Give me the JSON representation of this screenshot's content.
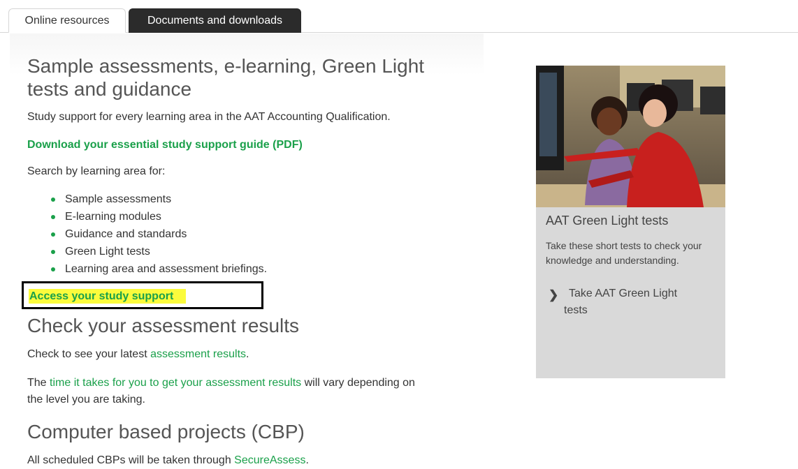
{
  "tabs": [
    {
      "label": "Online resources"
    },
    {
      "label": "Documents and downloads"
    }
  ],
  "section1": {
    "heading_line1": "Sample assessments, e-learning, Green Light",
    "heading_line2": "tests and guidance",
    "intro": "Study support for every learning area in the AAT Accounting Qualification.",
    "guide_link": "Download your essential study support guide (PDF)",
    "search_label": "Search by learning area for:",
    "bullets": [
      "Sample assessments",
      "E-learning modules",
      "Guidance and standards",
      "Green Light tests",
      "Learning area and assessment briefings."
    ],
    "access_link": "Access your study support"
  },
  "section2": {
    "heading": "Check your assessment results",
    "line1_prefix": "Check to see your latest ",
    "line1_link": "assessment results",
    "line1_suffix": ".",
    "line2_prefix": "The ",
    "line2_link": "time it takes for you to get your assessment results",
    "line2_suffix": " will vary depending on",
    "line3": "the level you are taking."
  },
  "section3": {
    "heading": "Computer based projects (CBP)",
    "line_prefix": "All scheduled CBPs will be taken through ",
    "line_link": "SecureAssess",
    "line_suffix": "."
  },
  "card": {
    "title": "AAT Green Light tests",
    "desc": "Take these short tests to check your knowledge and understanding.",
    "link_line1": "Take AAT Green Light",
    "link_line2": "tests"
  },
  "colors": {
    "link_green": "#1aa04a",
    "active_tab": "#2b2b2b",
    "card_bg": "#d9d9d9",
    "highlight": "#fbfb3c"
  }
}
